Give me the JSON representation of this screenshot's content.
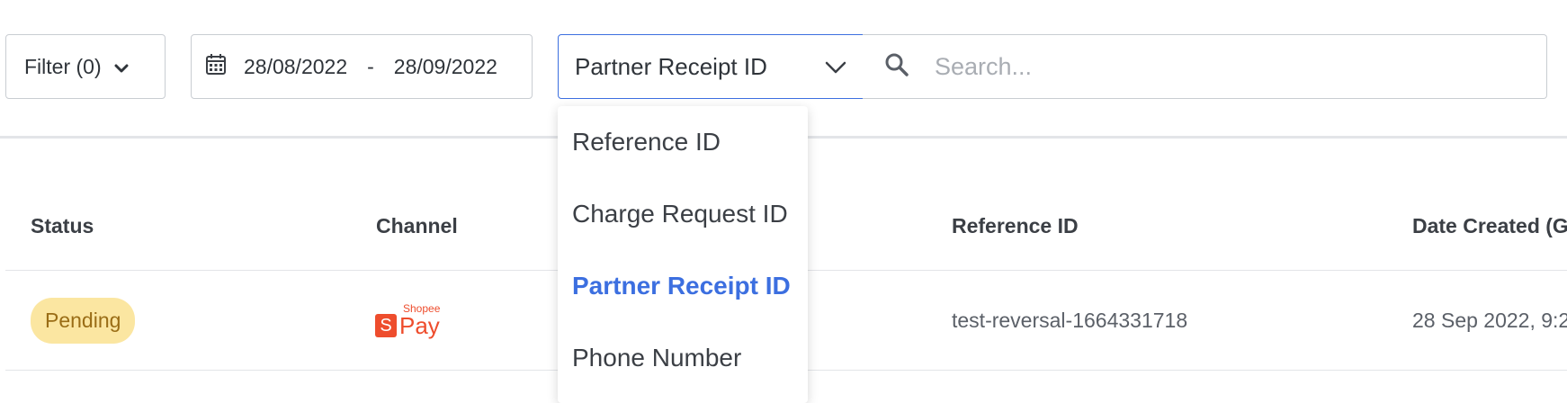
{
  "toolbar": {
    "filter_label": "Filter (0)",
    "date_start": "28/08/2022",
    "date_separator": "-",
    "date_end": "28/09/2022",
    "search_field_selected": "Partner Receipt ID",
    "search_placeholder": "Search..."
  },
  "dropdown": {
    "options": [
      {
        "label": "Reference ID"
      },
      {
        "label": "Charge Request ID"
      },
      {
        "label": "Partner Receipt ID",
        "selected": true
      },
      {
        "label": "Phone Number"
      }
    ]
  },
  "table": {
    "columns": [
      "Status",
      "Channel",
      "Reference ID",
      "Date Created (G"
    ],
    "rows": [
      {
        "status": "Pending",
        "channel_logo_small": "Shopee",
        "channel_logo_s": "S",
        "channel_logo_big": "Pay",
        "reference_id": "test-reversal-1664331718",
        "date_created": "28 Sep 2022, 9:2"
      }
    ]
  },
  "colors": {
    "accent": "#3c6fe0",
    "pending_bg": "#fbe6a1",
    "pending_text": "#9a6d16",
    "shopee": "#ee4d2d"
  },
  "icons": [
    "chevron-down-icon",
    "calendar-icon",
    "search-icon",
    "shopeepay-logo"
  ]
}
